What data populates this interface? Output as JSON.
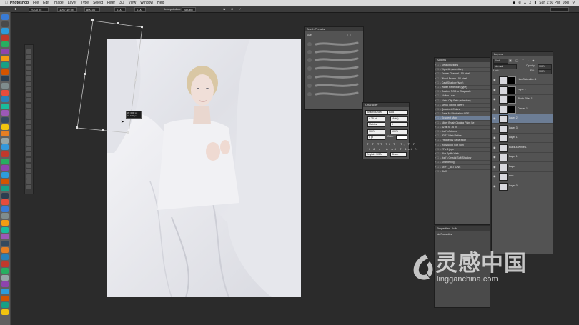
{
  "menubar": {
    "app": "Photoshop",
    "items": [
      "File",
      "Edit",
      "Image",
      "Layer",
      "Type",
      "Select",
      "Filter",
      "3D",
      "View",
      "Window",
      "Help"
    ],
    "clock": "Sun 1:50 PM",
    "user": "Joel"
  },
  "options": {
    "size": "70.00 px",
    "width": "1097.10 px",
    "height": "800.00",
    "angle": "0.00",
    "interpolation_label": "Interpolation:",
    "interpolation_value": "Bicubic"
  },
  "transform_readout": {
    "w": "W: 0.00 px",
    "h": "H: 0.00 px"
  },
  "brush_presets": {
    "title": "Brush Presets",
    "size_label": "Size:"
  },
  "character": {
    "title": "Character",
    "font": "Arial Rounded",
    "style": "Bold",
    "size": "4.75 pt",
    "leading": "(Auto)",
    "kerning": "Metrics",
    "tracking": "0",
    "vscale": "100%",
    "hscale": "100%",
    "baseline": "0 pt",
    "color_label": "Color:",
    "language": "English: USA",
    "aa": "Sharp"
  },
  "actions": {
    "title": "Actions",
    "items": [
      "Default Actions",
      "Vignette (selection)",
      "Frame Channel - 50 pixel",
      "Wood Frame - 50 pixel",
      "Cast Shadow (type)",
      "Water Reflection (type)",
      "Custom RGB to Grayscale",
      "Molten Lead",
      "Make Clip Path (selection)",
      "Sepia Toning (layer)",
      "Quadrant Colors",
      "Save As Photoshop PDF",
      "Gradient Map",
      "Mixer Brush Cloning Paint Se",
      "32 bit to 16 bit",
      "Joel's Actions",
      "JDPT Web Retina",
      "Frequency Separation",
      "Hollywood Soft Skin",
      "27 x 6 jpgs",
      "Blur Spiffy Web",
      "Joel's Crystal Soft Shadow",
      "Sharpening",
      "DEFT_ACTIONS",
      "Stuff"
    ]
  },
  "properties": {
    "tab1": "Properties",
    "tab2": "Info",
    "status": "No Properties"
  },
  "layers": {
    "title": "Layers",
    "kind": "Kind",
    "blend": "Normal",
    "opacity_label": "Opacity:",
    "opacity": "100%",
    "fill_label": "Fill:",
    "fill": "100%",
    "lock_label": "Lock:",
    "items": [
      {
        "name": "Hue/Saturation 1",
        "mask": "black"
      },
      {
        "name": "Layer 1",
        "mask": "black"
      },
      {
        "name": "Photo Filter 1",
        "mask": "black"
      },
      {
        "name": "Curves 1",
        "mask": "black"
      },
      {
        "name": "Layer 2",
        "mask": "none"
      },
      {
        "name": "Layer 3",
        "mask": "none"
      },
      {
        "name": "Layer 1",
        "mask": "none"
      },
      {
        "name": "Black & White 1",
        "mask": "none"
      },
      {
        "name": "Layer 1",
        "mask": "none"
      },
      {
        "name": "Layer",
        "mask": "none"
      },
      {
        "name": "mas",
        "mask": "none"
      },
      {
        "name": "Layer 0",
        "mask": "none"
      }
    ]
  },
  "watermark": {
    "text": "灵感中国",
    "url": "lingganchina.com"
  },
  "colors": {
    "bg": "#2b2b2b",
    "panel": "#535353",
    "selected_layer": "#6c7d95"
  }
}
